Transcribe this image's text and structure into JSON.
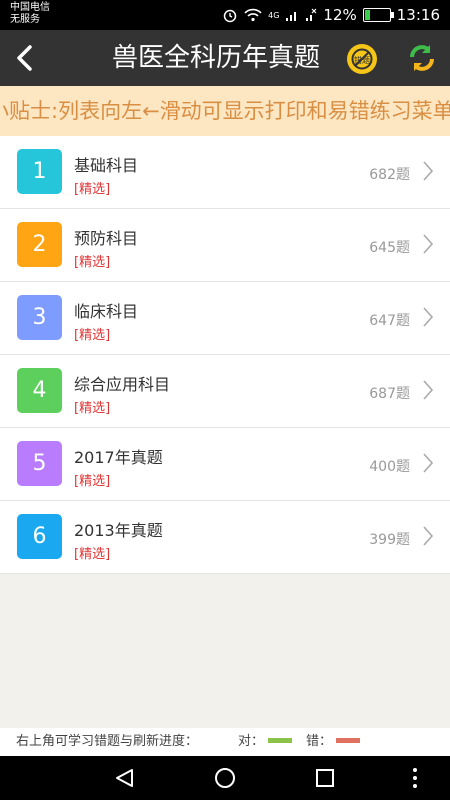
{
  "status": {
    "carrier_line1": "中国电信",
    "carrier_line2": "无服务",
    "network": "4G",
    "battery_text": "12%",
    "time": "13:16"
  },
  "header": {
    "title": "兽医全科历年真题",
    "wrong_badge": "错题",
    "back_icon": "back-arrow-icon",
    "refresh_icon": "refresh-icon"
  },
  "tip": {
    "text": "小贴士:列表向左←滑动可显示打印和易错练习菜单，长"
  },
  "subjects": [
    {
      "index": "1",
      "name": "基础科目",
      "tag": "[精选]",
      "count": "682题",
      "color": "#26c6da"
    },
    {
      "index": "2",
      "name": "预防科目",
      "tag": "[精选]",
      "count": "645题",
      "color": "#ffa412"
    },
    {
      "index": "3",
      "name": "临床科目",
      "tag": "[精选]",
      "count": "647题",
      "color": "#7e9cff"
    },
    {
      "index": "4",
      "name": "综合应用科目",
      "tag": "[精选]",
      "count": "687题",
      "color": "#5ccf5c"
    },
    {
      "index": "5",
      "name": "2017年真题",
      "tag": "[精选]",
      "count": "400题",
      "color": "#b97cff"
    },
    {
      "index": "6",
      "name": "2013年真题",
      "tag": "[精选]",
      "count": "399题",
      "color": "#1aa9f0"
    }
  ],
  "footer": {
    "text": "右上角可学习错题与刷新进度：",
    "correct_label": "对：",
    "wrong_label": "错：",
    "correct_color": "#8bc34a",
    "wrong_color": "#e07060"
  }
}
